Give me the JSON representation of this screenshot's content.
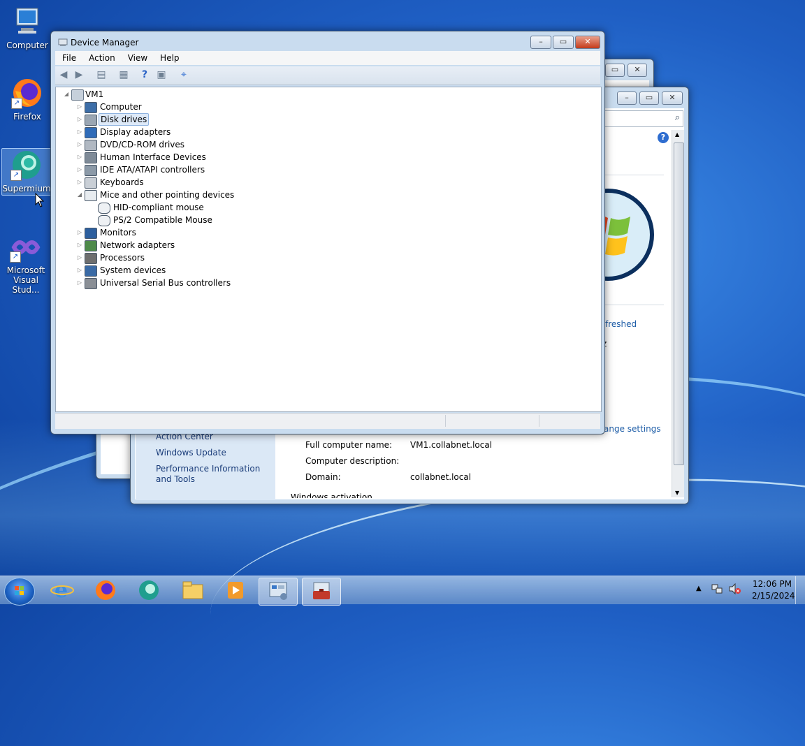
{
  "desktop": {
    "icons": [
      {
        "label": "Computer"
      },
      {
        "label": "Firefox"
      },
      {
        "label": "Supermium"
      },
      {
        "label": "Microsoft Visual Stud..."
      }
    ]
  },
  "device_manager": {
    "title": "Device Manager",
    "menu": [
      "File",
      "Action",
      "View",
      "Help"
    ],
    "root": "VM1",
    "nodes": [
      {
        "label": "Computer",
        "icon": "computer-icon"
      },
      {
        "label": "Disk drives",
        "icon": "disk-drive-icon",
        "selected": true
      },
      {
        "label": "Display adapters",
        "icon": "display-adapter-icon"
      },
      {
        "label": "DVD/CD-ROM drives",
        "icon": "dvd-drive-icon"
      },
      {
        "label": "Human Interface Devices",
        "icon": "hid-icon"
      },
      {
        "label": "IDE ATA/ATAPI controllers",
        "icon": "ide-controller-icon"
      },
      {
        "label": "Keyboards",
        "icon": "keyboard-icon"
      },
      {
        "label": "Mice and other pointing devices",
        "icon": "mouse-icon",
        "expanded": true,
        "children": [
          "HID-compliant mouse",
          "PS/2 Compatible Mouse"
        ]
      },
      {
        "label": "Monitors",
        "icon": "monitor-icon"
      },
      {
        "label": "Network adapters",
        "icon": "network-adapter-icon"
      },
      {
        "label": "Processors",
        "icon": "processor-icon"
      },
      {
        "label": "System devices",
        "icon": "system-devices-icon"
      },
      {
        "label": "Universal Serial Bus controllers",
        "icon": "usb-icon"
      }
    ]
  },
  "system_window": {
    "left_pane": [
      "Action Center",
      "Windows Update",
      "Performance Information and Tools"
    ],
    "fields": [
      {
        "label": "Full computer name:",
        "value": "VM1.collabnet.local"
      },
      {
        "label": "Computer description:",
        "value": ""
      },
      {
        "label": "Domain:",
        "value": "collabnet.local"
      }
    ],
    "partial_link_1": "freshed",
    "partial_text_2": "z",
    "change_settings": "ange settings",
    "bottom_cut": "Windows activation"
  },
  "taskbar": {
    "time": "12:06 PM",
    "date": "2/15/2024"
  }
}
